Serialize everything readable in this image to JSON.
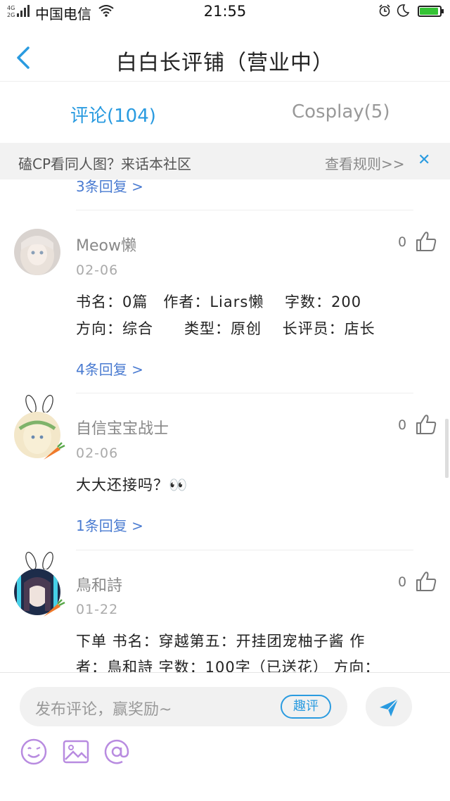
{
  "status_bar": {
    "carrier": "中国电信",
    "time": "21:55"
  },
  "header": {
    "title": "白白长评铺（营业中）"
  },
  "tabs": [
    {
      "label": "评论(104)",
      "active": true
    },
    {
      "label": "Cosplay(5)",
      "active": false
    }
  ],
  "notice": {
    "text": "磕CP看同人图？来话本社区",
    "rules_link": "查看规则>>",
    "close_glyph": "✕"
  },
  "list": {
    "top_reply_link": "3条回复 >",
    "comments": [
      {
        "username": "Meow懒",
        "date": "02-06",
        "likes": "0",
        "lines": [
          "书名：0篇　作者：Liars懒　 字数：200",
          "方向：综合　　类型：原创　 长评员：店长"
        ],
        "replies": "4条回复 >"
      },
      {
        "username": "自信宝宝战士",
        "date": "02-06",
        "likes": "0",
        "lines": [
          "大大还接吗？👀"
        ],
        "replies": "1条回复 >"
      },
      {
        "username": "鳥和詩",
        "date": "01-22",
        "likes": "0",
        "lines": [
          "下单 书名：穿越第五：开挂团宠柚子酱 作",
          "者：鳥和詩 字数：100字（已送花） 方向："
        ]
      }
    ]
  },
  "composer": {
    "placeholder": "发布评论，赢奖励~",
    "qp_label": "趣评"
  },
  "colors": {
    "accent": "#2a9be0",
    "link": "#4a7bd1",
    "tool_icon": "#b88be0"
  }
}
